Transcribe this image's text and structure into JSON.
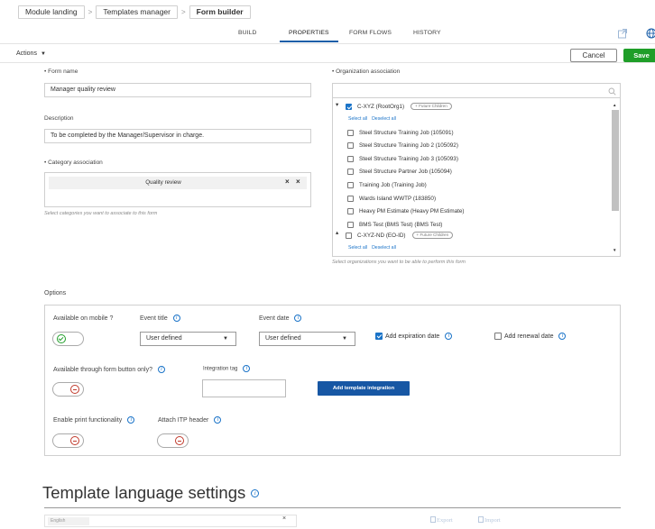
{
  "breadcrumb": {
    "items": [
      "Module landing",
      "Templates manager",
      "Form builder"
    ],
    "separator": ">"
  },
  "tabs": [
    "BUILD",
    "PROPERTIES",
    "FORM FLOWS",
    "HISTORY"
  ],
  "active_tab": "PROPERTIES",
  "icons": {
    "share": "share-external-icon",
    "globe": "globe-icon"
  },
  "actions_bar": {
    "actions_label": "Actions",
    "cancel_label": "Cancel",
    "save_label": "Save"
  },
  "form_name": {
    "label": "Form name",
    "value": "Manager quality review"
  },
  "description": {
    "label": "Description",
    "value": "To be completed by the Manager/Supervisor in charge."
  },
  "category": {
    "label": "Category association",
    "chip": "Quality review",
    "hint": "Select categories you want to associate to this form"
  },
  "organization": {
    "label": "Organization association",
    "hint": "Select organizations you want to be able to perform this form",
    "root": {
      "name": "C-XYZ (RootOrg1)",
      "checked": true,
      "pill": "+ Future Children"
    },
    "select_all": "Select all",
    "deselect_all": "Deselect all",
    "children": [
      "Steel Structure Training Job (105091)",
      "Steel Structure Training Job 2 (105092)",
      "Steel Structure Training Job 3 (105093)",
      "Steel Structure Partner Job (105094)",
      "Training Job (Training Job)",
      "Wards Island WWTP (183850)",
      "Heavy PM Estimate (Heavy PM Estimate)",
      "BMS Test (BMS Test) (BMS Test)"
    ],
    "second": {
      "name": "C-XYZ-ND (EO-ID)",
      "checked": false,
      "pill": "+ Future Children"
    }
  },
  "options": {
    "title": "Options",
    "available_on_mobile": {
      "label": "Available on mobile ?",
      "on": true
    },
    "event_title": {
      "label": "Event title",
      "value": "User defined"
    },
    "event_date": {
      "label": "Event date",
      "value": "User defined"
    },
    "add_expiration_date": {
      "label": "Add expiration date",
      "checked": true
    },
    "add_renewal_date": {
      "label": "Add renewal date",
      "checked": false
    },
    "form_button_only": {
      "label": "Available through form button only?",
      "on": false
    },
    "integration_tag": {
      "label": "Integration tag",
      "value": ""
    },
    "add_template_integration": "Add template integration",
    "enable_print": {
      "label": "Enable print functionality",
      "on": false
    },
    "attach_itp": {
      "label": "Attach ITP header",
      "on": false
    }
  },
  "template_language": {
    "title": "Template language settings",
    "language_chip": "English",
    "export_label": "Export",
    "import_label": "Import"
  },
  "colors": {
    "accent_blue": "#1a73c8",
    "save_green": "#1f9e28",
    "button_blue": "#1757a4",
    "toggle_off_red": "#c0392b"
  }
}
